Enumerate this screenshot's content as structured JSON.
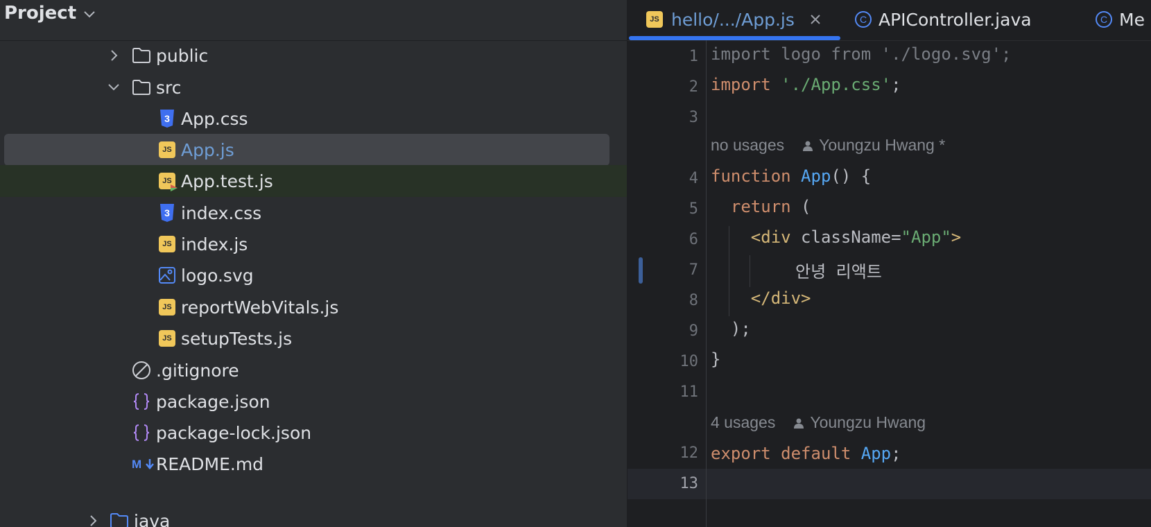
{
  "project_panel": {
    "title": "Project",
    "tree": [
      {
        "label": "public",
        "icon": "folder-icon",
        "expanded": false
      },
      {
        "label": "src",
        "icon": "folder-icon",
        "expanded": true
      },
      {
        "label": "App.css",
        "icon": "css-file-icon"
      },
      {
        "label": "App.js",
        "icon": "js-file-icon",
        "selected": true
      },
      {
        "label": "App.test.js",
        "icon": "js-test-file-icon"
      },
      {
        "label": "index.css",
        "icon": "css-file-icon"
      },
      {
        "label": "index.js",
        "icon": "js-file-icon"
      },
      {
        "label": "logo.svg",
        "icon": "image-file-icon"
      },
      {
        "label": "reportWebVitals.js",
        "icon": "js-file-icon"
      },
      {
        "label": "setupTests.js",
        "icon": "js-file-icon"
      },
      {
        "label": ".gitignore",
        "icon": "ignore-file-icon"
      },
      {
        "label": "package.json",
        "icon": "json-file-icon"
      },
      {
        "label": "package-lock.json",
        "icon": "json-file-icon"
      },
      {
        "label": "README.md",
        "icon": "markdown-file-icon"
      },
      {
        "label": "java",
        "icon": "folder-icon",
        "expanded": false
      }
    ]
  },
  "tabs": [
    {
      "label": "hello/.../App.js",
      "icon": "js-file-icon",
      "active": true
    },
    {
      "label": "APIController.java",
      "icon": "class-icon"
    },
    {
      "label": "Me",
      "icon": "class-icon"
    }
  ],
  "editor": {
    "line_numbers": [
      "1",
      "2",
      "3",
      "4",
      "5",
      "6",
      "7",
      "8",
      "9",
      "10",
      "11",
      "12",
      "13"
    ],
    "hints": [
      {
        "usages": "no usages",
        "author": "Youngzu Hwang *"
      },
      {
        "usages": "4 usages",
        "author": "Youngzu Hwang"
      }
    ],
    "code": {
      "l1": "import logo from './logo.svg';",
      "l2_kw": "import",
      "l2_str": "'./App.css'",
      "l2_end": ";",
      "l4_kw": "function",
      "l4_fn": "App",
      "l4_end": "() {",
      "l5_kw": "return",
      "l5_end": " (",
      "l6_open": "<div",
      "l6_attr": " className",
      "l6_eq": "=",
      "l6_val": "\"App\"",
      "l6_close": ">",
      "l7_text": "안녕 리액트",
      "l8_tag": "</div>",
      "l9": ");",
      "l10": "}",
      "l12_kw1": "export",
      "l12_kw2": "default",
      "l12_fn": "App",
      "l12_end": ";"
    }
  },
  "colors": {
    "keyword": "#cf8e6d",
    "string": "#6aab73",
    "function": "#56a8f5",
    "tag": "#d5b778",
    "accent": "#3574f0"
  }
}
